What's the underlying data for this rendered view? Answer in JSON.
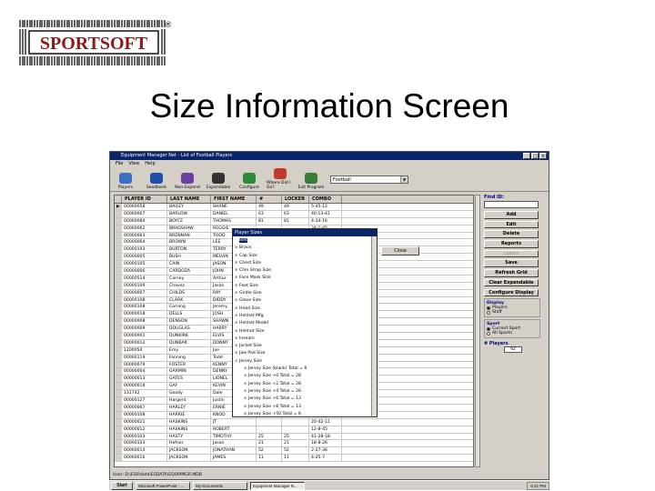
{
  "logo": {
    "text": "SPORTSOFT",
    "reg": "®"
  },
  "slide_title": "Size Information Screen",
  "window": {
    "title": "Equipment Manager Net - List of Football Players",
    "menu": [
      "File",
      "View",
      "Help"
    ],
    "toolbar": [
      "Players",
      "Seedbank",
      "Non-Expend",
      "Expendable",
      "Configure",
      "Where Did I Go?",
      "Exit Program"
    ],
    "sport_select": "Football",
    "grid_headers": [
      "",
      "PLAYER ID",
      "LAST NAME",
      "FIRST NAME",
      "#",
      "LOCKER",
      "COMBO"
    ],
    "rows": [
      [
        "▶",
        "00000058",
        "BAILEY",
        "SHANE",
        "49",
        "49",
        "5-45-12"
      ],
      [
        "",
        "00000067",
        "BARLOW",
        "DANIEL",
        "63",
        "63",
        "40-13-41"
      ],
      [
        "",
        "00000084",
        "BOYCE",
        "THOMAS",
        "81",
        "81",
        "4-34-16"
      ],
      [
        "",
        "00000062",
        "BRADSHAW",
        "REGGIE",
        "",
        "",
        "34-1-45"
      ],
      [
        "",
        "00000063",
        "BRENNAN",
        "TODD",
        "",
        "",
        "3-23-12"
      ],
      [
        "",
        "00000064",
        "BROWN",
        "LEE",
        "",
        "",
        "2-41-4"
      ],
      [
        "",
        "00000103",
        "BURTON",
        "TERRY",
        "",
        "",
        "12-34-5"
      ],
      [
        "",
        "00000005",
        "BUSH",
        "MELVIN",
        "",
        "",
        "6-41-23"
      ],
      [
        "",
        "00000105",
        "CAIN",
        "JASON",
        "",
        "",
        "4-40-3"
      ],
      [
        "",
        "00000006",
        "CARDOZA",
        "JOHN",
        "",
        "",
        "15-28-16"
      ],
      [
        "",
        "00000514",
        "Carney",
        "Arthur",
        "",
        "",
        "7-28-35"
      ],
      [
        "",
        "00000109",
        "Chavez",
        "Jason",
        "",
        "",
        "45-27-7"
      ],
      [
        "",
        "00000007",
        "CHILDS",
        "RAY",
        "",
        "",
        "24-45-32"
      ],
      [
        "",
        "00000108",
        "CLARK",
        "DIDDY",
        "",
        "",
        "29-6-47"
      ],
      [
        "",
        "00000108",
        "Corning",
        "Jeremy",
        "",
        "",
        "24-2-11"
      ],
      [
        "",
        "00000018",
        "DELLS",
        "JOSH",
        "",
        "",
        "16-27-6"
      ],
      [
        "",
        "00000008",
        "DENSON",
        "SHAWN",
        "",
        "",
        "31-27-8"
      ],
      [
        "",
        "00000009",
        "DOUGLAS",
        "HARRY",
        "",
        "",
        "19-10-38"
      ],
      [
        "",
        "00000001",
        "DUNKIRK",
        "ELVIS",
        "",
        "",
        "38-30-8"
      ],
      [
        "",
        "00000012",
        "DUNBAR",
        "DONNY",
        "",
        "",
        "45-3-18"
      ],
      [
        "",
        "1200050",
        "Emy",
        "Joe",
        "",
        "",
        "23-11-12"
      ],
      [
        "",
        "00000119",
        "Fanning",
        "Todd",
        "",
        "",
        "12-40-45"
      ],
      [
        "",
        "00000079",
        "FOSTER",
        "KENNY",
        "",
        "",
        "38-2-31"
      ],
      [
        "",
        "00000004",
        "GARMIN",
        "DENNY",
        "",
        "",
        "6-31-24"
      ],
      [
        "",
        "00000013",
        "GATES",
        "LIONEL",
        "",
        "",
        "15-40-7"
      ],
      [
        "",
        "00000018",
        "GAY",
        "KEVIN",
        "",
        "",
        "12-46-40"
      ],
      [
        "",
        "131742",
        "Goody",
        "Dale",
        "",
        "",
        "13-3-2"
      ],
      [
        "",
        "00000127",
        "Hargent",
        "Justin",
        "",
        "",
        "17-20-5"
      ],
      [
        "",
        "00000067",
        "HARLEY",
        "ERNIE",
        "",
        "",
        "24-1-41"
      ],
      [
        "",
        "00000108",
        "HARRIE",
        "KNOD",
        "",
        "",
        "8-27-1"
      ],
      [
        "",
        "00000021",
        "HASKINS",
        "JT",
        "",
        "",
        "20-42-11"
      ],
      [
        "",
        "00000012",
        "HASKINS",
        "ROBERT",
        "",
        "",
        "12-8-45"
      ],
      [
        "",
        "00000103",
        "HASTY",
        "TIMOTHY",
        "25",
        "25",
        "41-28-18"
      ],
      [
        "",
        "00000103",
        "Hefner",
        "Jason",
        "21",
        "21",
        "18-8-26"
      ],
      [
        "",
        "00000014",
        "JACKSON",
        "JONATHAN",
        "52",
        "52",
        "2-27-36"
      ],
      [
        "",
        "00000016",
        "JACKSON",
        "JAMES",
        "11",
        "11",
        "4-25-7"
      ]
    ],
    "find_label": "Find ID:",
    "right_buttons": [
      "Add",
      "Edit",
      "Delete",
      "Reports",
      "Labels",
      "Save",
      "Refresh Grid",
      "Clear Expendable",
      "Configure Display"
    ],
    "display_group": {
      "title": "Display",
      "opts": [
        "Players",
        "Staff"
      ]
    },
    "sport_group": {
      "title": "Sport",
      "opts": [
        "Current Sport",
        "All Sports"
      ]
    },
    "players_label": "# Players",
    "players_count": "92",
    "status": "User:    D:\\ESII\\data\\ESDATA\\EQUIPMGR.MDB",
    "popup": {
      "title": "Player Sizes",
      "lines": [
        {
          "t": "Belt",
          "bx": "",
          "ind": 0,
          "sel": true
        },
        {
          "t": "Brace",
          "bx": "⊞",
          "ind": 0
        },
        {
          "t": "Cap Size",
          "bx": "⊞",
          "ind": 0
        },
        {
          "t": "Chest Size",
          "bx": "⊞",
          "ind": 0
        },
        {
          "t": "Chin Strap Size",
          "bx": "⊞",
          "ind": 0
        },
        {
          "t": "Face Mask Size",
          "bx": "⊞",
          "ind": 0
        },
        {
          "t": "Foot Size",
          "bx": "⊞",
          "ind": 0
        },
        {
          "t": "Girdle Size",
          "bx": "⊞",
          "ind": 0
        },
        {
          "t": "Glove Size",
          "bx": "⊞",
          "ind": 0
        },
        {
          "t": "Head Size",
          "bx": "⊞",
          "ind": 0
        },
        {
          "t": "Helmet Mfg",
          "bx": "⊞",
          "ind": 0
        },
        {
          "t": "Helmet Model",
          "bx": "⊞",
          "ind": 0
        },
        {
          "t": "Helmet Size",
          "bx": "⊞",
          "ind": 0
        },
        {
          "t": "Inseam",
          "bx": "⊞",
          "ind": 0
        },
        {
          "t": "Jacket Size",
          "bx": "⊞",
          "ind": 0
        },
        {
          "t": "Jaw Pad Size",
          "bx": "⊞",
          "ind": 0
        },
        {
          "t": "Jersey Size",
          "bx": "⊟",
          "ind": 0
        },
        {
          "t": "Jersey Size (blank)  Total = 6",
          "bx": "⊞",
          "ind": 1
        },
        {
          "t": "Jersey Size +0   Total = 28",
          "bx": "⊞",
          "ind": 1
        },
        {
          "t": "Jersey Size +2   Total = 28",
          "bx": "⊞",
          "ind": 1
        },
        {
          "t": "Jersey Size +4   Total = 26",
          "bx": "⊞",
          "ind": 1
        },
        {
          "t": "Jersey Size +6   Total = 13",
          "bx": "⊞",
          "ind": 1
        },
        {
          "t": "Jersey Size +8   Total = 13",
          "bx": "⊞",
          "ind": 1
        },
        {
          "t": "Jersey Size +50   Total = 6",
          "bx": "⊞",
          "ind": 1
        },
        {
          "t": "Jock_Str",
          "bx": "⊞",
          "ind": 0
        },
        {
          "t": "Knee Pad Size",
          "bx": "⊞",
          "ind": 0
        }
      ],
      "close_label": "Close"
    }
  },
  "taskbar": {
    "start": "Start",
    "tasks": [
      "Microsoft PowerPoint - ...",
      "My Documents",
      "Equipment Manager N..."
    ],
    "clock": "5:21 PM"
  }
}
